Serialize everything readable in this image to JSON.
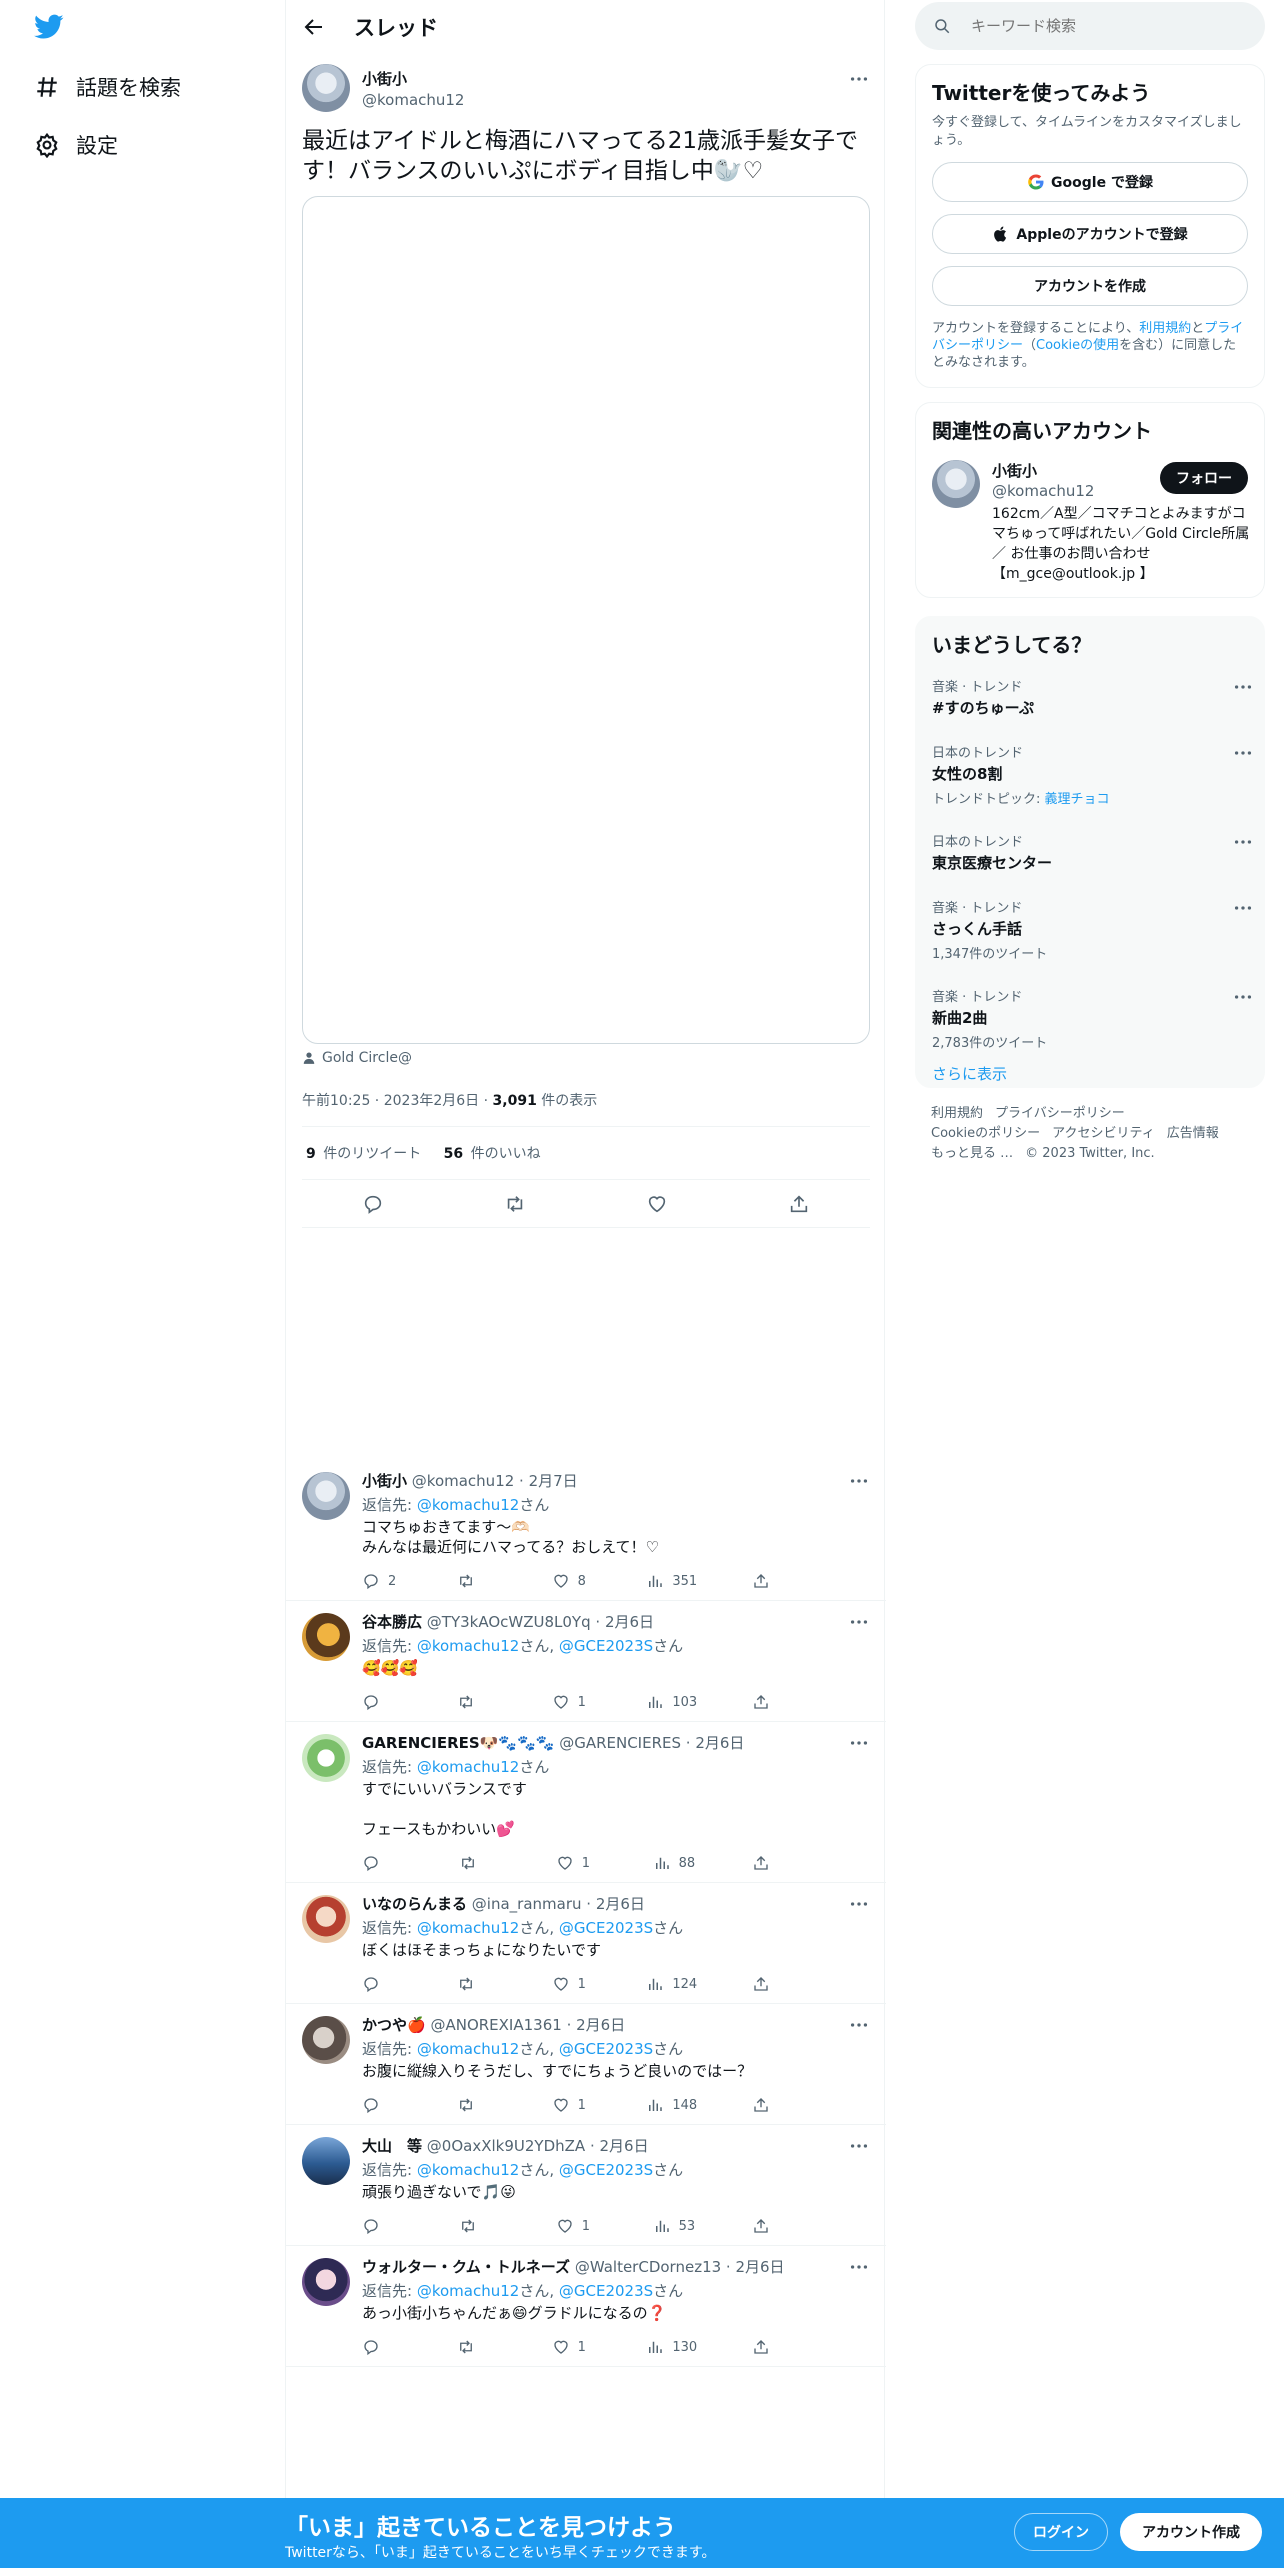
{
  "nav": {
    "explore_label": "話題を検索",
    "settings_label": "設定"
  },
  "header": {
    "title": "スレッド"
  },
  "main_post": {
    "name": "小街小",
    "handle": "@komachu12",
    "text": "最近はアイドルと梅酒にハマってる21歳派手髪女子です！バランスのいいぷにボディ目指し中🦭♡",
    "attribution": "Gold Circle@",
    "time": "午前10:25",
    "date": "2023年2月6日",
    "views_count": "3,091",
    "views_label": " 件の表示",
    "retweets_count": "9",
    "retweets_label": " 件のリツイート",
    "likes_count": "56",
    "likes_label": " 件のいいね"
  },
  "reply_to_label": "返信先: ",
  "san": "さん",
  "replies": [
    {
      "name": "小街小",
      "handle": "@komachu12",
      "date": "2月7日",
      "to": "@komachu12",
      "to2": "",
      "text1": "コマちゅおきてます〜🫶🏻",
      "text2": "みんなは最近何にハマってる？おしえて！♡",
      "replies": "2",
      "retweets": "",
      "likes": "8",
      "views": "351"
    },
    {
      "name": "谷本勝広",
      "handle": "@TY3kAOcWZU8L0Yq",
      "date": "2月6日",
      "to": "@komachu12",
      "to2": "@GCE2023S",
      "text1": "🥰🥰🥰",
      "text2": "",
      "replies": "",
      "retweets": "",
      "likes": "1",
      "views": "103"
    },
    {
      "name": "GARENCIERES🐶🐾🐾🐾",
      "handle": "@GARENCIERES",
      "date": "2月6日",
      "to": "@komachu12",
      "to2": "",
      "text1": "すでにいいバランスです",
      "text2": "フェースもかわいい💕",
      "replies": "",
      "retweets": "",
      "likes": "1",
      "views": "88"
    },
    {
      "name": "いなのらんまる",
      "handle": "@ina_ranmaru",
      "date": "2月6日",
      "to": "@komachu12",
      "to2": "@GCE2023S",
      "text1": "ぼくはほそまっちょになりたいです",
      "text2": "",
      "replies": "",
      "retweets": "",
      "likes": "1",
      "views": "124"
    },
    {
      "name": "かつや🍎",
      "handle": "@ANOREXIA1361",
      "date": "2月6日",
      "to": "@komachu12",
      "to2": "@GCE2023S",
      "text1": "お腹に縦線入りそうだし、すでにちょうど良いのではー？",
      "text2": "",
      "replies": "",
      "retweets": "",
      "likes": "1",
      "views": "148"
    },
    {
      "name": "大山　等",
      "handle": "@0OaxXlk9U2YDhZA",
      "date": "2月6日",
      "to": "@komachu12",
      "to2": "@GCE2023S",
      "text1": "頑張り過ぎないで🎵😜",
      "text2": "",
      "replies": "",
      "retweets": "",
      "likes": "1",
      "views": "53"
    },
    {
      "name": "ウォルター・クム・トルネーズ",
      "handle": "@WalterCDornez13",
      "date": "2月6日",
      "to": "@komachu12",
      "to2": "@GCE2023S",
      "text1": "あっ小街小ちゃんだぁ😄グラドルになるの❓",
      "text2": "",
      "replies": "",
      "retweets": "",
      "likes": "1",
      "views": "130"
    }
  ],
  "search": {
    "placeholder": "キーワード検索"
  },
  "signup_card": {
    "title": "Twitterを使ってみよう",
    "subtitle": "今すぐ登録して、タイムラインをカスタマイズしましょう。",
    "google_label": "Google で登録",
    "apple_label": "Appleのアカウントで登録",
    "create_label": "アカウントを作成",
    "legal_1": "アカウントを登録することにより、",
    "legal_terms": "利用規約",
    "legal_and": "と",
    "legal_privacy": "プライバシーポリシー",
    "legal_2": "（",
    "legal_cookie": "Cookieの使用",
    "legal_3": "を含む）に同意したとみなされます。"
  },
  "related": {
    "title": "関連性の高いアカウント",
    "name": "小街小",
    "handle": "@komachu12",
    "follow_label": "フォロー",
    "bio": "162cm／A型／コマチコとよみますがコマちゅって呼ばれたい／Gold Circle所属／ お仕事のお問い合わせ【m_gce@outlook.jp 】"
  },
  "trends": {
    "title": "いまどうしてる？",
    "items": [
      {
        "context": "音楽 · トレンド",
        "name": "#すのちゅーぷ",
        "sub": "",
        "sub_link": ""
      },
      {
        "context": "日本のトレンド",
        "name": "女性の8割",
        "sub": "トレンドトピック: ",
        "sub_link": "義理チョコ"
      },
      {
        "context": "日本のトレンド",
        "name": "東京医療センター",
        "sub": "",
        "sub_link": ""
      },
      {
        "context": "音楽 · トレンド",
        "name": "さっくん手話",
        "sub": "1,347件のツイート",
        "sub_link": ""
      },
      {
        "context": "音楽 · トレンド",
        "name": "新曲2曲",
        "sub": "2,783件のツイート",
        "sub_link": ""
      }
    ],
    "show_more": "さらに表示"
  },
  "footer": {
    "terms": "利用規約",
    "privacy": "プライバシーポリシー",
    "cookie": "Cookieのポリシー",
    "accessibility": "アクセシビリティ",
    "ads": "広告情報",
    "more": "もっと見る …",
    "copyright": "© 2023 Twitter, Inc."
  },
  "bottom_bar": {
    "title": "「いま」起きていることを見つけよう",
    "subtitle": "Twitterなら、「いま」起きていることをいち早くチェックできます。",
    "login_label": "ログイン",
    "signup_label": "アカウント作成"
  },
  "colors": {
    "accent": "#1d9bf0",
    "text": "#0f1419",
    "muted": "#536471",
    "border": "#eff3f4"
  }
}
